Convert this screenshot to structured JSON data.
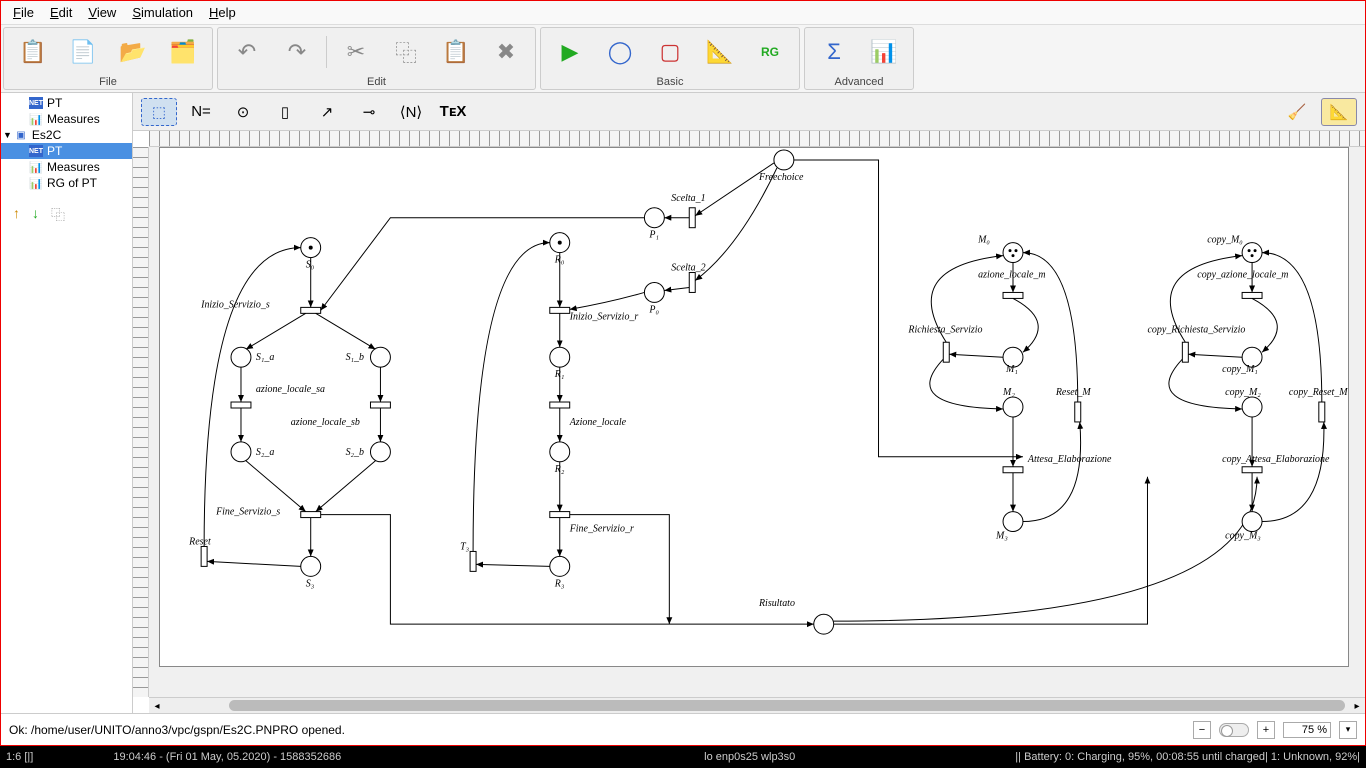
{
  "menu": {
    "file": "File",
    "edit": "Edit",
    "view": "View",
    "simulation": "Simulation",
    "help": "Help"
  },
  "groups": {
    "file": "File",
    "edit": "Edit",
    "basic": "Basic",
    "advanced": "Advanced"
  },
  "tree": {
    "pt": "PT",
    "measures": "Measures",
    "project": "Es2C",
    "pt2": "PT",
    "measures2": "Measures",
    "rg": "RG of PT"
  },
  "canvasTools": {
    "neq": "N=",
    "angN": "⟨N⟩",
    "tex": "TᴇX"
  },
  "net": {
    "freechoice": "Freechoice",
    "scelta1": "Scelta_1",
    "p1": "P₁",
    "scelta2": "Scelta_2",
    "p0": "P₀",
    "s0": "S₀",
    "inizio_s": "Inizio_Servizio_s",
    "s1a": "S₁_a",
    "s1b": "S₁_b",
    "azione_sa": "azione_locale_sa",
    "azione_sb": "azione_locale_sb",
    "s2a": "S₂_a",
    "s2b": "S₂_b",
    "fine_s": "Fine_Servizio_s",
    "reset": "Reset",
    "s3": "S₃",
    "r0": "R₀",
    "inizio_r": "Inizio_Servizio_r",
    "r1": "R₁",
    "azione_locale": "Azione_locale",
    "r2": "R₂",
    "fine_r": "Fine_Servizio_r",
    "t3": "T₃",
    "r3": "R₃",
    "risultato": "Risultato",
    "m0": "M₀",
    "azione_m": "azione_locale_m",
    "richiesta": "Richiesta_Servizio",
    "m1": "M₁",
    "m2": "M₂",
    "attesa": "Attesa_Elaborazione",
    "m3": "M₃",
    "reset_m": "Reset_M",
    "copy_m0": "copy_M₀",
    "copy_azione": "copy_azione_locale_m",
    "copy_richiesta": "copy_Richiesta_Servizio",
    "copy_m1": "copy_M₁",
    "copy_m2": "copy_M₂",
    "copy_attesa": "copy_Attesa_Elaborazione",
    "copy_m3": "copy_M₃",
    "copy_reset": "copy_Reset_M"
  },
  "status": {
    "text": "Ok: /home/user/UNITO/anno3/vpc/gspn/Es2C.PNPRO opened.",
    "zoom": "75 %"
  },
  "panel": {
    "left": "1:6 [|]",
    "time": "19:04:46 - (Fri 01 May, 05.2020) - 1588352686",
    "net": "lo enp0s25 wlp3s0",
    "bat": "||   Battery: 0: Charging, 95%, 00:08:55 until charged| 1: Unknown, 92%|"
  }
}
